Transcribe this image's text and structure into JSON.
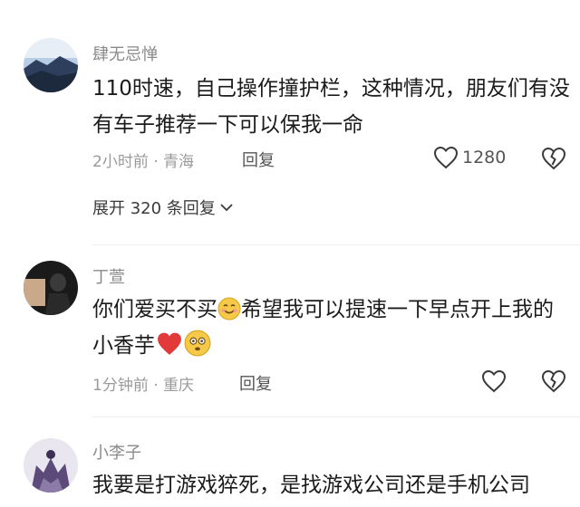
{
  "comments": [
    {
      "username": "肆无忌惮",
      "text": "110时速，自己操作撞护栏，这种情况，朋友们有没有车子推荐一下可以保我一命",
      "meta": "2小时前 · 青海",
      "reply_label": "回复",
      "like_count": "1280",
      "expand_label": "展开 320 条回复"
    },
    {
      "username": "丁萱",
      "text_part1": "你们爱买不买",
      "text_part2": "希望我可以提速一下早点开上我的小香芋",
      "meta": "1分钟前 · 重庆",
      "reply_label": "回复"
    },
    {
      "username": "小李子",
      "text": "我要是打游戏猝死，是找游戏公司还是手机公司"
    }
  ],
  "icons": {
    "like": "heart-outline-icon",
    "dislike": "broken-heart-icon",
    "expand": "chevron-down-icon",
    "emoji_smile": "smiling-face-emoji",
    "emoji_heart": "red-heart-emoji",
    "emoji_dizzy": "dizzy-face-emoji"
  },
  "colors": {
    "heart_red": "#e23a3a",
    "emoji_yellow": "#f7c948"
  }
}
